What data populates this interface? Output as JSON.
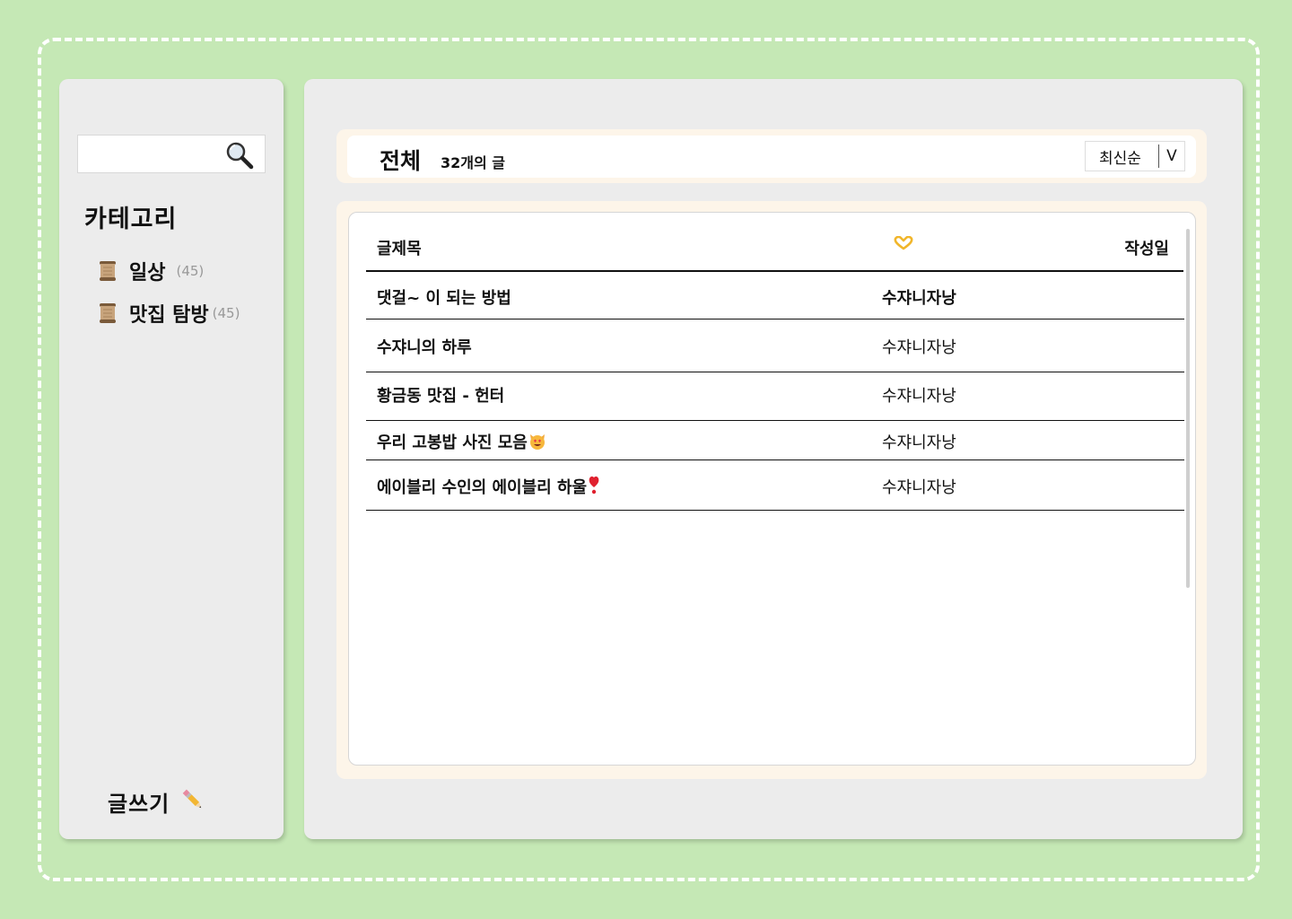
{
  "sidebar": {
    "search": {
      "placeholder": "",
      "value": ""
    },
    "category_title": "카테고리",
    "categories": [
      {
        "label": "일상",
        "count": "(45)",
        "icon": "scroll-icon"
      },
      {
        "label": "맛집 탐방",
        "count": "(45)",
        "icon": "scroll-icon"
      }
    ],
    "write_label": "글쓰기",
    "write_icon": "pencil-icon"
  },
  "header": {
    "title": "전체",
    "count_text": "32개의 글",
    "sort": {
      "selected": "최신순",
      "arrow": "V"
    }
  },
  "list": {
    "columns": {
      "title": "글제목",
      "author_icon": "heart-hands-icon",
      "date": "작성일"
    },
    "posts": [
      {
        "title": "댓걸~ 이 되는 방법",
        "author": "수쟈니자낭",
        "title_emoji": ""
      },
      {
        "title": "수쟈니의 하루",
        "author": "수쟈니자낭",
        "title_emoji": ""
      },
      {
        "title": "황금동 맛집 - 헌터",
        "author": "수쟈니자낭",
        "title_emoji": ""
      },
      {
        "title": "우리 고봉밥 사진 모음",
        "author": "수쟈니자낭",
        "title_emoji": "heart-eyes-cat-icon"
      },
      {
        "title": "에이블리 수인의 에이블리 하울",
        "author": "수쟈니자낭",
        "title_emoji": "heart-exclamation-icon"
      }
    ]
  },
  "colors": {
    "background": "#c5e8b5",
    "panel": "#ececec",
    "cream": "#fdf5e9",
    "dash": "#ffffff"
  }
}
